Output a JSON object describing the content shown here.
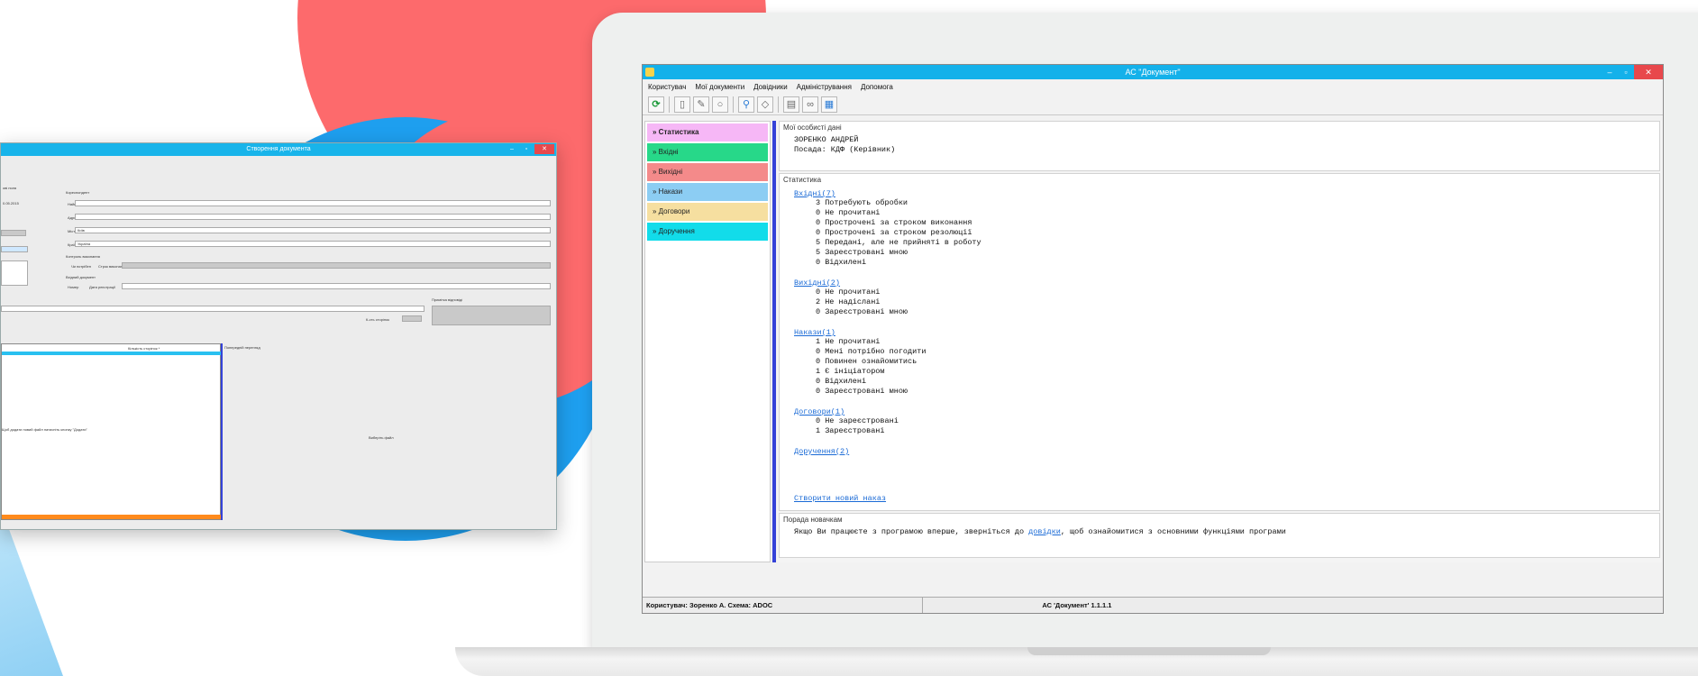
{
  "main_window": {
    "title": "АС \"Документ\"",
    "controls": {
      "minimize": "–",
      "maximize": "▫",
      "close": "✕"
    },
    "menu": [
      "Користувач",
      "Мої документи",
      "Довідники",
      "Адміністрування",
      "Допомога"
    ],
    "sidebar": [
      {
        "label": "» Статистика",
        "color": "#f6b7f6"
      },
      {
        "label": "» Вхідні",
        "color": "#27d889"
      },
      {
        "label": "» Вихідні",
        "color": "#f48a8a"
      },
      {
        "label": "» Накази",
        "color": "#8ccdf3"
      },
      {
        "label": "» Договори",
        "color": "#f6dfa0"
      },
      {
        "label": "» Доручення",
        "color": "#12dcea"
      }
    ],
    "personal": {
      "header": "Мої особисті дані",
      "name": "ЗОРЕНКО АНДРЕЙ",
      "position": "Посада: КДФ (Керівник)"
    },
    "stats": {
      "header": "Статистика",
      "groups": [
        {
          "link": "Вхідні(7)",
          "lines": [
            "3 Потребують обробки",
            "0 Не прочитані",
            "0 Прострочені за строком виконання",
            "0 Прострочені за строком резолюції",
            "5 Передані, але не прийняті в роботу",
            "5 Зареєстровані мною",
            "0 Відхилені"
          ]
        },
        {
          "link": "Вихідні(2)",
          "lines": [
            "0 Не прочитані",
            "2 Не надіслані",
            "0 Зареєстровані мною"
          ]
        },
        {
          "link": "Накази(1)",
          "lines": [
            "1 Не прочитані",
            "0 Мені потрібно погодити",
            "0 Повинен ознайомитись",
            "1 Є ініціатором",
            "0 Відхилені",
            "0 Зареєстровані мною"
          ]
        },
        {
          "link": "Договори(1)",
          "lines": [
            "0 Не зареєстровані",
            "1 Зареєстровані"
          ]
        },
        {
          "link": "Доручення(2)",
          "lines": []
        }
      ],
      "create_link": "Створити новий наказ"
    },
    "tips": {
      "header": "Порада новачкам",
      "before": "Якщо Ви працюєте з програмою вперше, зверніться до ",
      "link": "довідки",
      "after": ", щоб ознайомитися з основними функціями програми"
    },
    "status": {
      "user": "Користувач: Зоренко А. Схема: ADOC",
      "app": "АС 'Документ' 1.1.1.1"
    }
  },
  "back_window": {
    "title": "Створення документа",
    "labels": {
      "correspondent": "Кореспондент",
      "naming": "Найменування",
      "address": "Адреса",
      "city": "Місто *",
      "city_val": "Київ",
      "country": "Країна *",
      "country_val": "Україна",
      "control": "Контроль виконання",
      "needs": "Чи потрібен",
      "term": "Строк виконання",
      "incoming": "Вхідний документ",
      "number": "Номер",
      "reg_date": "Дата реєстрації",
      "receipt": "Примітка відповіді",
      "pages": "Кількість сторінок *",
      "preview": "Попередній перегляд",
      "pages_count": "К-сть сторінок",
      "hint": "Щоб додати новий файл натисніть кнопку \"Додати\"",
      "choose": "Виберіть файл",
      "date_frag": "0.05.2015",
      "fields_frag": "ові поля"
    }
  },
  "colors": {
    "accent": "#14b1ea",
    "divider": "#3442d8",
    "link": "#1a6ad6",
    "close": "#e8484c"
  }
}
